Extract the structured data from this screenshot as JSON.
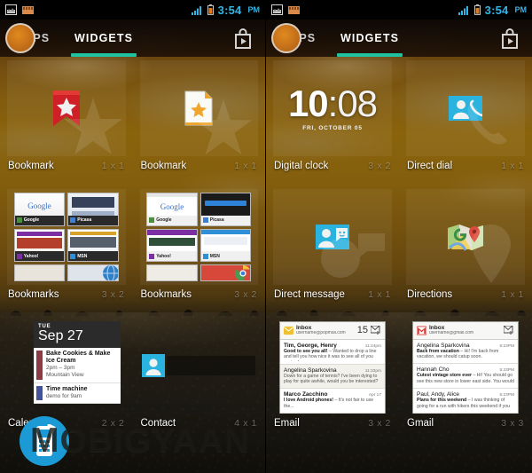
{
  "statusbar": {
    "icons": [
      "screenshot-icon",
      "sd-card-icon"
    ],
    "signal_icon": "signal-bars-icon",
    "battery_icon": "battery-icon",
    "time": "3:54",
    "ampm": "PM",
    "time_color": "#33b5e5"
  },
  "tabs": {
    "apps_label": "APPS",
    "widgets_label": "WIDGETS",
    "selected": "WIDGETS",
    "accent_color": "#1fc3a0",
    "playstore_icon": "play-store-bag-icon"
  },
  "left_screen": {
    "widgets": [
      {
        "name": "Bookmark",
        "size": "1 x 1",
        "icon": "bookmark-ribbon-star-icon",
        "preview_type": "icon"
      },
      {
        "name": "Bookmark",
        "size": "1 x 1",
        "icon": "document-star-icon",
        "preview_type": "icon"
      },
      {
        "name": "Bookmarks",
        "size": "3 x 2",
        "icon": "bookmarks-grid-icon",
        "preview_type": "bookmarks-dark",
        "tiles": [
          {
            "label": "Google",
            "fav_color": "#4a8f3c"
          },
          {
            "label": "Picasa",
            "fav_color": "#3f7fd0"
          },
          {
            "label": "Yahoo!",
            "fav_color": "#7b2fa3"
          },
          {
            "label": "MSN",
            "fav_color": "#2e8fd6"
          }
        ]
      },
      {
        "name": "Bookmarks",
        "size": "3 x 2",
        "icon": "bookmarks-grid-icon",
        "preview_type": "bookmarks-light",
        "tiles": [
          {
            "label": "Google",
            "fav_color": "#4a8f3c"
          },
          {
            "label": "Picasa",
            "fav_color": "#3f7fd0"
          },
          {
            "label": "Yahoo!",
            "fav_color": "#7b2fa3"
          },
          {
            "label": "MSN",
            "fav_color": "#2e8fd6"
          }
        ]
      },
      {
        "name": "Calendar",
        "size": "2 x 2",
        "icon": "calendar-icon",
        "preview_type": "calendar",
        "calendar": {
          "dow": "TUE",
          "date": "Sep 27",
          "events": [
            {
              "chip_color": "#8c3b45",
              "title": "Bake Cookies & Make Ice Cream",
              "time": "2pm  –  3pm",
              "location": "Mountain View"
            },
            {
              "chip_color": "#42529c",
              "title": "Time machine",
              "time": "demo for 9am",
              "location": ""
            }
          ]
        }
      },
      {
        "name": "Contact",
        "size": "4 x 1",
        "icon": "contact-person-icon",
        "preview_type": "contact-bar"
      }
    ]
  },
  "right_screen": {
    "widgets": [
      {
        "name": "Digital clock",
        "size": "3 x 2",
        "icon": "digital-clock-icon",
        "preview_type": "clock",
        "clock": {
          "hours": "10",
          "separator": ":",
          "minutes": "08",
          "date": "FRI, OCTOBER 05"
        }
      },
      {
        "name": "Direct dial",
        "size": "1 x 1",
        "icon": "direct-dial-icon",
        "preview_type": "icon"
      },
      {
        "name": "Direct message",
        "size": "1 x 1",
        "icon": "direct-message-icon",
        "preview_type": "icon"
      },
      {
        "name": "Directions",
        "size": "1 x 1",
        "icon": "google-maps-icon",
        "preview_type": "icon"
      },
      {
        "name": "Email",
        "size": "3 x 2",
        "icon": "email-icon",
        "preview_type": "mail",
        "mail": {
          "folder": "Inbox",
          "account": "username@popmail.com",
          "count": "15",
          "badge_icon": "email-envelope-badge-icon",
          "compose_icon": "compose-mail-icon",
          "items": [
            {
              "from": "Tim, George, Henry",
              "bold": true,
              "time": "11:24pm",
              "snippet_bold": "Good to see you all!",
              "snippet": " – Wanted to drop a line and tell you how nice it was to see all of you yesterd..."
            },
            {
              "from": "Angelina Sparkovina",
              "bold": false,
              "time": "11:33pm",
              "snippet_bold": "",
              "snippet": "Down for a game of tennis? I've been dying to play for quite awhile, would you be interested?"
            },
            {
              "from": "Marco Zacchino",
              "bold": true,
              "time": "Apr 17",
              "snippet_bold": "I love Android phones!",
              "snippet": " – It's not fair to use the..."
            }
          ]
        }
      },
      {
        "name": "Gmail",
        "size": "3 x 3",
        "icon": "gmail-icon",
        "preview_type": "mail",
        "mail": {
          "folder": "Inbox",
          "account": "username@gmail.com",
          "count": "",
          "badge_icon": "gmail-m-badge-icon",
          "compose_icon": "compose-mail-icon",
          "items": [
            {
              "from": "Angelina Sparkovina",
              "bold": false,
              "time": "5:23PM",
              "snippet_bold": "Back from vacation",
              "snippet": " – Hi! I'm back from vacation, we should catup soon."
            },
            {
              "from": "Hannah Cho",
              "bold": false,
              "time": "5:23PM",
              "snippet_bold": "Cutest vintage store ever",
              "snippet": " – Hi! You should go see this new store in lower east side. You would love..."
            },
            {
              "from": "Paul, Andy, Alice",
              "bold": false,
              "time": "5:23PM",
              "snippet_bold": "Plans for this weekend",
              "snippet": " – I was thinking of going for a run with hikers this weekend if you guys want..."
            }
          ]
        }
      }
    ]
  },
  "watermark": {
    "text": "MOBIGYAAN",
    "logo_icon": "mobile-phone-logo-icon",
    "logo_color": "#1b9ad6"
  }
}
